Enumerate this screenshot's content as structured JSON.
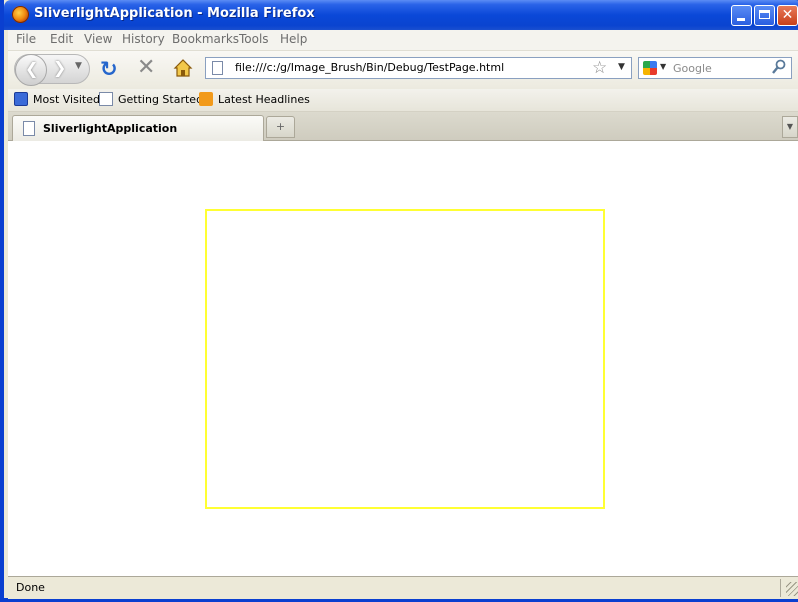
{
  "window": {
    "title": "SliverlightApplication - Mozilla Firefox"
  },
  "menu": {
    "items": [
      "File",
      "Edit",
      "View",
      "History",
      "Bookmarks",
      "Tools",
      "Help"
    ]
  },
  "navigation": {
    "url": "file:///c:/g/Image_Brush/Bin/Debug/TestPage.html",
    "search_placeholder": "Google",
    "search_engine_icon": "google-icon"
  },
  "bookmarks": {
    "items": [
      {
        "label": "Most Visited",
        "icon": "most-visited-icon"
      },
      {
        "label": "Getting Started",
        "icon": "page-icon"
      },
      {
        "label": "Latest Headlines",
        "icon": "rss-feed-icon"
      }
    ]
  },
  "tabs": [
    {
      "label": "SliverlightApplication",
      "active": true
    }
  ],
  "content": {
    "plugin_border_color": "#ffff33",
    "background": "#ffffff"
  },
  "status": {
    "text": "Done"
  }
}
